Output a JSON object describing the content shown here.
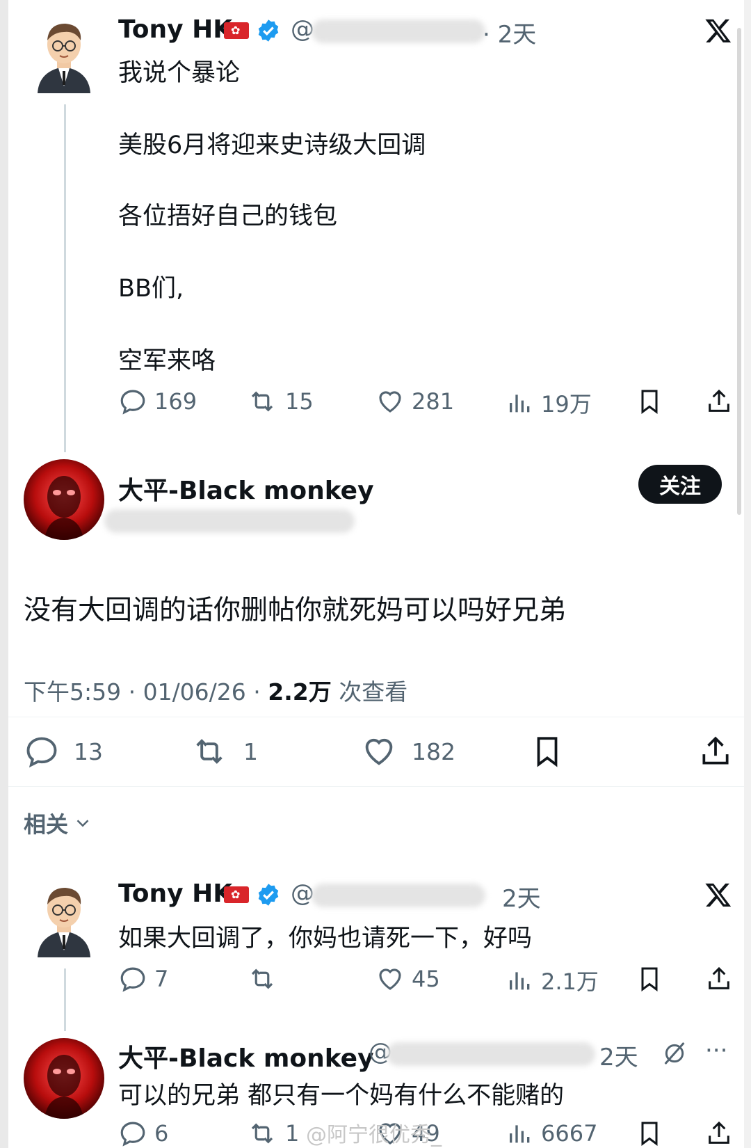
{
  "tweet1": {
    "name": "Tony HK",
    "handle_prefix": "@",
    "time": "· 2天",
    "lines": [
      "我说个暴论",
      "美股6月将迎来史诗级大回调",
      "各位捂好自己的钱包",
      "BB们,",
      "空军来咯"
    ],
    "actions": {
      "reply": "169",
      "retweet": "15",
      "like": "281",
      "views": "19万"
    }
  },
  "main_reply": {
    "name": "大平-Black monkey",
    "follow_label": "关注",
    "text": "没有大回调的话你删帖你就死妈可以吗好兄弟",
    "time": "下午5:59 · 01/06/26 · ",
    "views": "2.2万",
    "views_label": " 次查看",
    "actions": {
      "reply": "13",
      "retweet": "1",
      "like": "182"
    }
  },
  "related_label": "相关",
  "tweet2": {
    "name": "Tony HK",
    "handle_prefix": "@",
    "time": "2天",
    "text": "如果大回调了，你妈也请死一下，好吗",
    "actions": {
      "reply": "7",
      "like": "45",
      "views": "2.1万"
    }
  },
  "tweet3": {
    "name": "大平-Black monkey",
    "handle_prefix": "@",
    "time": "2天",
    "more": "···",
    "text": "可以的兄弟 都只有一个妈有什么不能赌的",
    "actions": {
      "reply": "6",
      "retweet": "1",
      "like": "49",
      "views": "6667"
    }
  },
  "watermark": "@阿宁很优秀_",
  "colors": {
    "text": "#0f1419",
    "secondary": "#536471",
    "verified": "#1d9bf0",
    "flag": "#d9252a"
  }
}
